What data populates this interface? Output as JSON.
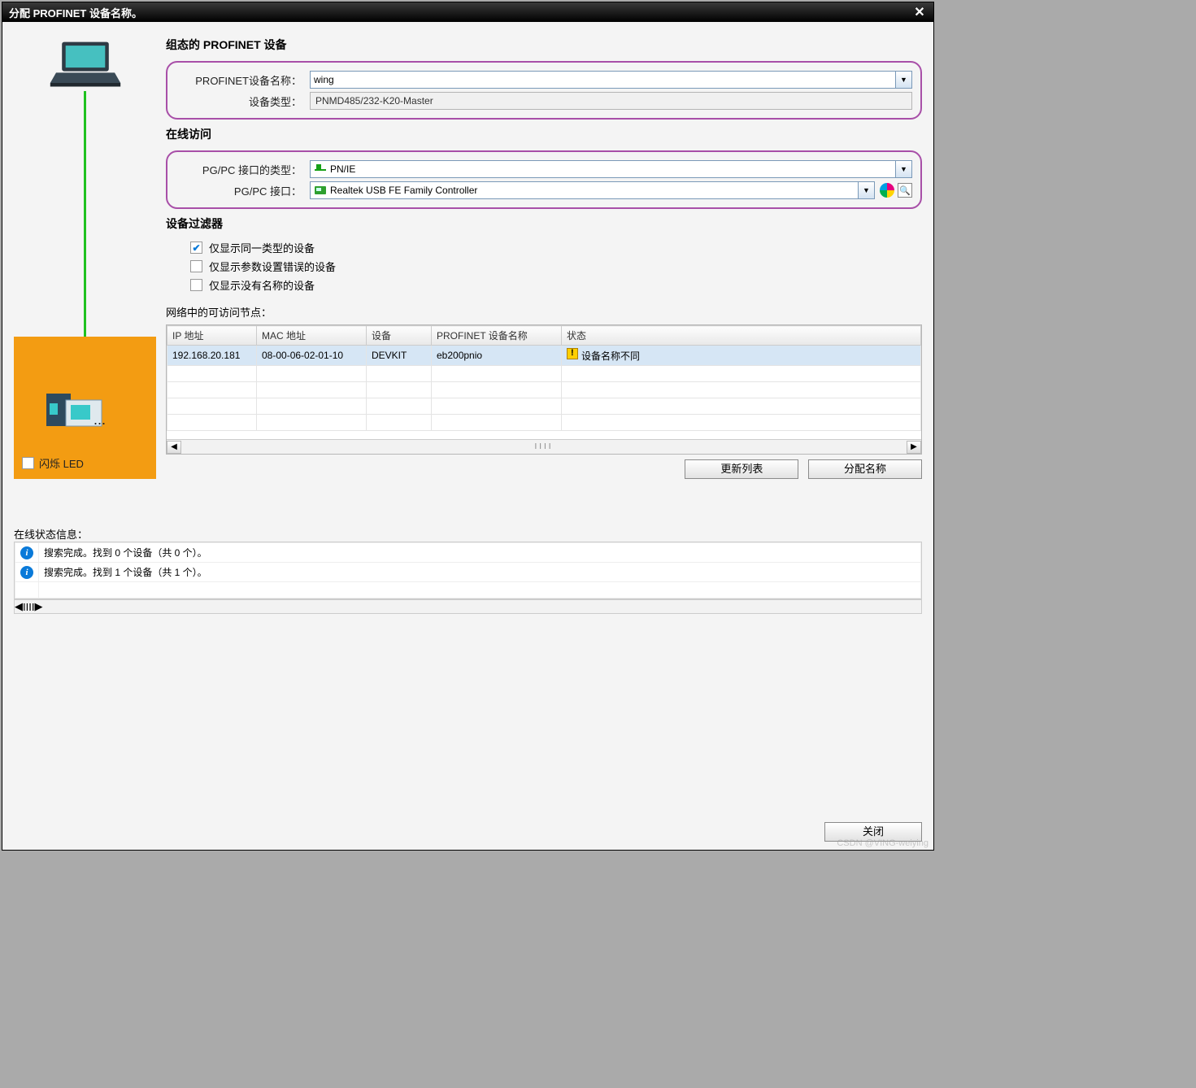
{
  "title": "分配 PROFINET 设备名称。",
  "sections": {
    "configured": "组态的 PROFINET 设备",
    "online": "在线访问",
    "filter": "设备过滤器"
  },
  "fields": {
    "pn_name_lbl": "PROFINET设备名称：",
    "pn_name_val": "wing",
    "dev_type_lbl": "设备类型：",
    "dev_type_val": "PNMD485/232-K20-Master",
    "if_type_lbl": "PG/PC 接口的类型：",
    "if_type_val": "PN/IE",
    "if_lbl": "PG/PC 接口：",
    "if_val": "Realtek USB FE Family Controller"
  },
  "filters": {
    "same_type": "仅显示同一类型的设备",
    "bad_param": "仅显示参数设置错误的设备",
    "no_name": "仅显示没有名称的设备"
  },
  "led_label": "闪烁 LED",
  "nodes_label": "网络中的可访问节点：",
  "columns": {
    "ip": "IP 地址",
    "mac": "MAC 地址",
    "dev": "设备",
    "pn": "PROFINET 设备名称",
    "status": "状态"
  },
  "row": {
    "ip": "192.168.20.181",
    "mac": "08-00-06-02-01-10",
    "dev": "DEVKIT",
    "pn": "eb200pnio",
    "status": "设备名称不同"
  },
  "buttons": {
    "refresh": "更新列表",
    "assign": "分配名称",
    "close": "关闭"
  },
  "status_label": "在线状态信息：",
  "status_msgs": [
    "搜索完成。找到 0 个设备（共 0 个）。",
    "搜索完成。找到 1 个设备（共 1 个）。"
  ],
  "watermark": "CSDN @VING-weiying"
}
